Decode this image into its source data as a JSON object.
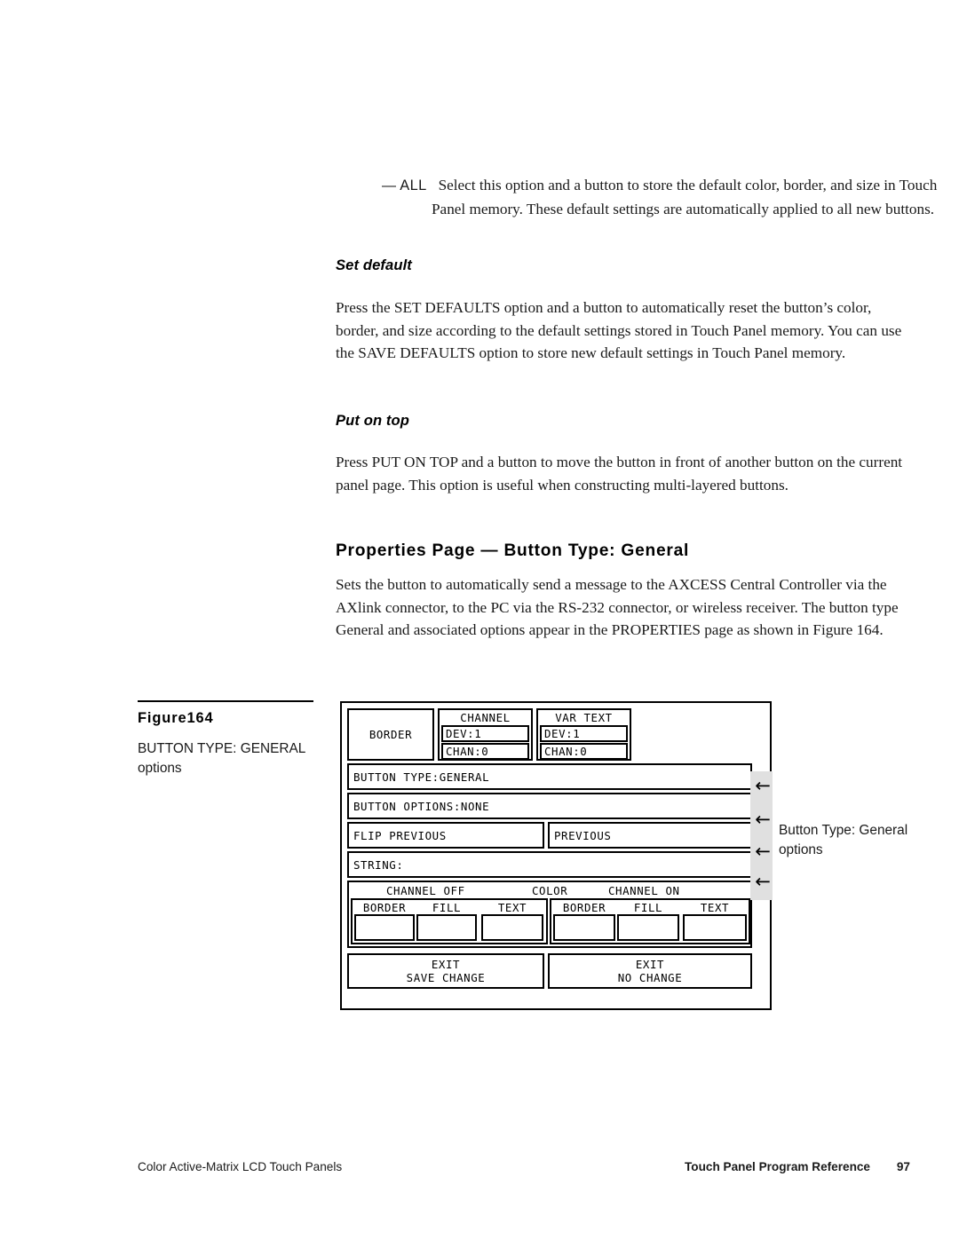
{
  "body": {
    "bullet": {
      "dash": "—",
      "key": "ALL",
      "text": "Select this option and a button to store the default color, border, and size in Touch Panel memory. These default settings are automatically applied to all new buttons."
    },
    "set_default_heading": "Set default",
    "set_default_text": "Press the SET DEFAULTS option and a button to automatically reset the button’s color, border, and size according to the default settings stored in Touch Panel memory. You can use the SAVE DEFAULTS option to store new default settings in Touch Panel memory.",
    "put_on_top_heading": "Put on top",
    "put_on_top_text": "Press PUT ON TOP and a button to move the button in front of another button on the current panel page. This option is useful when constructing multi-layered buttons.",
    "properties_heading": "Properties Page — Button Type: General",
    "properties_text": "Sets the button to automatically send a message to the AXCESS Central Controller via the AXlink connector, to the PC via the RS-232 connector, or wireless receiver. The button type General and associated options appear in the PROPERTIES page as shown in Figure 164."
  },
  "figure": {
    "number": "Figure164",
    "description_line1": "BUTTON TYPE: GENERAL",
    "description_line2": "options",
    "callout": {
      "line1": "Button Type: General",
      "line2": "options",
      "arrow_glyph": "←",
      "arrow_count": 4,
      "band_color": "#e0e0e0"
    },
    "panel": {
      "border_button": "BORDER",
      "channel": {
        "title": "CHANNEL",
        "dev": "DEV:1",
        "chan": "CHAN:0"
      },
      "var_text": {
        "title": "VAR TEXT",
        "dev": "DEV:1",
        "chan": "CHAN:0"
      },
      "row_button_type": "BUTTON TYPE:GENERAL",
      "row_button_options": "BUTTON OPTIONS:NONE",
      "row_flip": "FLIP PREVIOUS",
      "row_previous": "PREVIOUS",
      "row_string": "STRING:",
      "color_section": {
        "channel_off": "CHANNEL OFF",
        "color": "COLOR",
        "channel_on": "CHANNEL ON",
        "off_labels": [
          "BORDER",
          "FILL",
          "TEXT"
        ],
        "on_labels": [
          "BORDER",
          "FILL",
          "TEXT"
        ],
        "swatch_color": "#ffffff"
      },
      "exit_save": "EXIT\nSAVE CHANGE",
      "exit_nochange": "EXIT\nNO CHANGE"
    }
  },
  "footer": {
    "left": "Color Active-Matrix LCD Touch Panels",
    "right": "Touch Panel Program Reference",
    "page": "97"
  }
}
